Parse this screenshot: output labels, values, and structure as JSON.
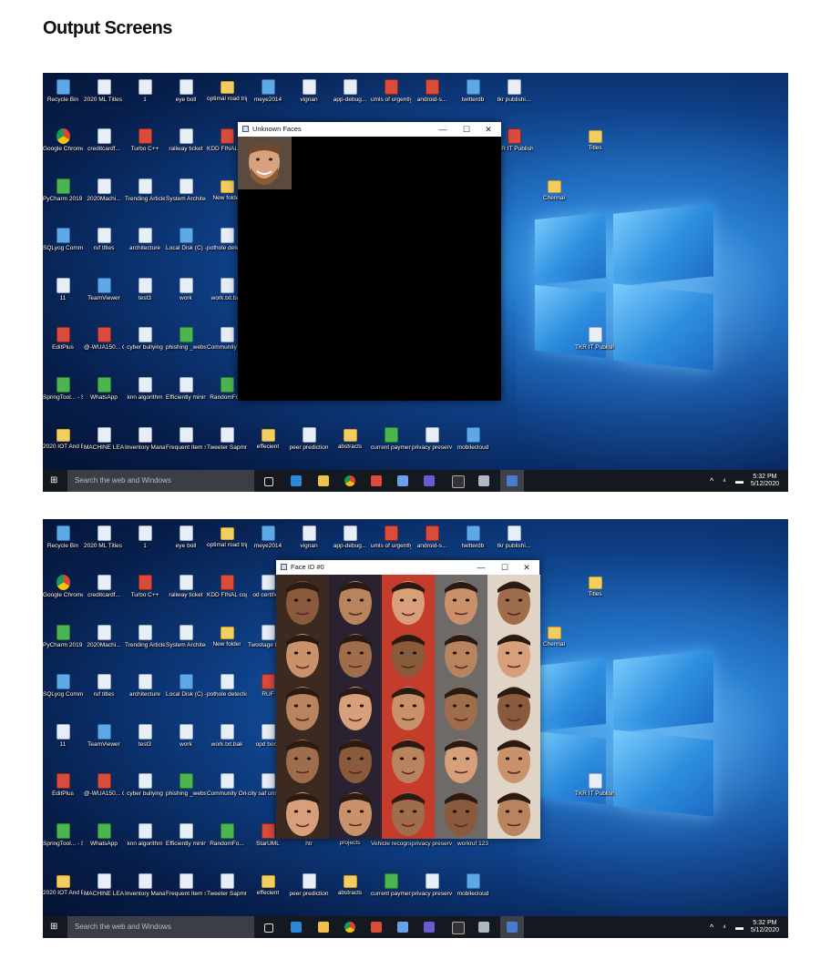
{
  "page_title": "Output Screens",
  "desktop_icons": [
    {
      "label": "Recycle Bin",
      "type": "app"
    },
    {
      "label": "2020 ML Titles am...",
      "type": "doc"
    },
    {
      "label": "1",
      "type": "doc"
    },
    {
      "label": "eye boll",
      "type": "doc"
    },
    {
      "label": "optimal road trip output",
      "type": "folder"
    },
    {
      "label": "meye2014",
      "type": "app"
    },
    {
      "label": "vignan",
      "type": "doc"
    },
    {
      "label": "app-debug...",
      "type": "doc"
    },
    {
      "label": "umls of urgently r...",
      "type": "red"
    },
    {
      "label": "android-s...",
      "type": "red"
    },
    {
      "label": "twitterdb",
      "type": "app"
    },
    {
      "label": "tkr publishi...",
      "type": "doc"
    },
    {
      "label": "Google Chrome",
      "type": "chrome"
    },
    {
      "label": "creditcardf...",
      "type": "doc"
    },
    {
      "label": "Turbo C++",
      "type": "red"
    },
    {
      "label": "raliway ticket",
      "type": "doc"
    },
    {
      "label": "KDD FINAL copy",
      "type": "red"
    },
    {
      "label": "od certific...",
      "type": "doc"
    },
    {
      "label": "PyCharm 2019.3.2 x64",
      "type": "green"
    },
    {
      "label": "2020Machi...",
      "type": "doc"
    },
    {
      "label": "Trending Article...",
      "type": "doc"
    },
    {
      "label": "System Architecture",
      "type": "doc"
    },
    {
      "label": "New folder",
      "type": "folder"
    },
    {
      "label": "Twostage Deduplic...",
      "type": "doc"
    },
    {
      "label": "SQLyog Communi...",
      "type": "app"
    },
    {
      "label": "ruf titles",
      "type": "doc"
    },
    {
      "label": "architecture",
      "type": "doc"
    },
    {
      "label": "Local Disk (C) - Sh...",
      "type": "app"
    },
    {
      "label": "pothole detectio...",
      "type": "doc"
    },
    {
      "label": "RUF",
      "type": "red"
    },
    {
      "label": "11",
      "type": "doc"
    },
    {
      "label": "TeamViewer",
      "type": "app"
    },
    {
      "label": "test3",
      "type": "doc"
    },
    {
      "label": "work",
      "type": "doc"
    },
    {
      "label": "work.txt.bak",
      "type": "doc"
    },
    {
      "label": "opd book",
      "type": "doc"
    },
    {
      "label": "EditPlus",
      "type": "red"
    },
    {
      "label": "@-WUA150... Client Utility",
      "type": "red"
    },
    {
      "label": "cyber bullying",
      "type": "doc"
    },
    {
      "label": "phishing _website",
      "type": "green"
    },
    {
      "label": "Community Oriented ...",
      "type": "doc"
    },
    {
      "label": "city saf unsafe.js",
      "type": "doc"
    },
    {
      "label": "SpringTool... - Shortcut",
      "type": "green"
    },
    {
      "label": "WhatsApp",
      "type": "green"
    },
    {
      "label": "knn algorithm",
      "type": "doc"
    },
    {
      "label": "Efficiently mining fre...",
      "type": "doc"
    },
    {
      "label": "RandomFo...",
      "type": "green"
    },
    {
      "label": "StarUML",
      "type": "red"
    },
    {
      "label": "htr",
      "type": "doc"
    },
    {
      "label": "projects",
      "type": "folder"
    },
    {
      "label": "Vehicle recognitio...",
      "type": "doc"
    },
    {
      "label": "privacy preservi...",
      "type": "doc"
    },
    {
      "label": "workruf 123",
      "type": "doc"
    },
    {
      "label": "2020 IOT And Embedded ...",
      "type": "folder"
    },
    {
      "label": "MACHINE LEARNING...",
      "type": "doc"
    },
    {
      "label": "Inventory Management",
      "type": "doc"
    },
    {
      "label": "Frequent Item set Wi...",
      "type": "doc"
    },
    {
      "label": "Tweeter Sapmm...",
      "type": "doc"
    },
    {
      "label": "effecient",
      "type": "folder"
    },
    {
      "label": "peer prediction",
      "type": "doc"
    },
    {
      "label": "abstracts",
      "type": "folder"
    },
    {
      "label": "current payments",
      "type": "green"
    },
    {
      "label": "privacy preservin...",
      "type": "doc"
    },
    {
      "label": "mobilecloud",
      "type": "app"
    },
    {
      "label": "TKR IT Publishi...",
      "type": "red"
    },
    {
      "label": "Titles",
      "type": "folder"
    },
    {
      "label": "Chennai",
      "type": "folder"
    },
    {
      "label": "TKR IT Publishi...",
      "type": "doc"
    }
  ],
  "screens": [
    {
      "window_title": "Unknown Faces",
      "window_controls": [
        "—",
        "☐",
        "✕"
      ]
    },
    {
      "window_title": "Face ID #0",
      "window_controls": [
        "—",
        "☐",
        "✕"
      ]
    }
  ],
  "taskbar": {
    "start": "⊞",
    "search_placeholder": "Search the web and Windows",
    "time": "5:32 PM",
    "date": "5/12/2020"
  },
  "colors": {
    "taskbar": "#14181f",
    "titlebar": "#ffffff",
    "window_body": "#000000"
  }
}
